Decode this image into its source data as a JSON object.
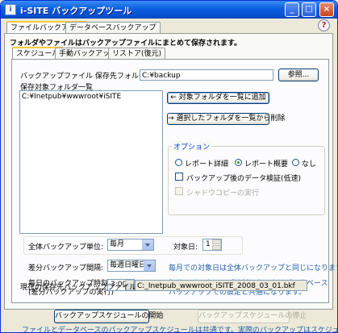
{
  "window": {
    "title": "i-SITE バックアップツール",
    "icon_text": "i"
  },
  "main_tabs": [
    "ファイルバックアップ",
    "データベースバックアップ"
  ],
  "header_text": "フォルダやファイルはバックアップファイルにまとめて保存されます。",
  "sub_tabs": [
    "スケジュール",
    "手動バックアップ",
    "リストア(復元)"
  ],
  "backup_folder": {
    "label": "バックアップファイル 保存先フォルダ名",
    "value": "C:¥backup",
    "browse_label": "参照..."
  },
  "target_list": {
    "label": "保存対象フォルダ一覧",
    "items": [
      "C:¥Inetpub¥wwwroot¥iSITE"
    ]
  },
  "buttons": {
    "add_label": "← 対象フォルダを一覧に追加",
    "remove_label": "→ 選択したフォルダを一覧から削除",
    "start_label": "バックアップスケジュールの開始",
    "stop_label": "バックアップスケジュールの停止"
  },
  "options": {
    "legend": "オプション",
    "radios": [
      "レポート詳細",
      "レポート概要",
      "なし"
    ],
    "selected": "レポート概要",
    "verify_label": "バックアップ後のデータ検証(低速)",
    "shadow_label": "シャドウコピーの実行"
  },
  "schedule": {
    "unit_label": "全体バックアップ単位:",
    "unit_value": "毎月",
    "target_day_label": "対象日:",
    "target_day_value": "1",
    "diff_label": "差分バックアップ間隔:",
    "diff_value": "毎週日曜日",
    "diff_note": "毎月での対象日は全体バックアップと同じになります。",
    "time_label_1": "毎日のバックアップ時刻:",
    "time_label_2": "(差分バックアップの実行)",
    "time_value": "3:00",
    "time_note_1": "毎日のバックアップ時刻とタスクはデータベース",
    "time_note_2": "バックアップでの設定と共通になります。",
    "current_label": "現在の保存先バックアップファイル名:",
    "current_value": "C:_Inetpub_wwwroot_iSITE_2008_03_01.bkf"
  },
  "footer_note": "ファイルとデータベースのバックアップスケジュールは共通です。実際のバックアップはスケジュールに従い実行されます。"
}
